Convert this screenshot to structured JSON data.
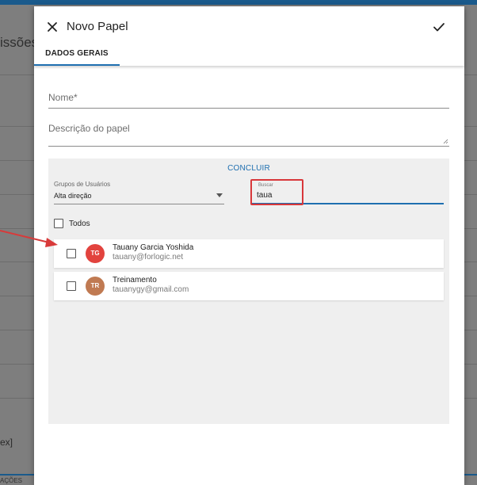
{
  "background": {
    "title_fragment": "issões",
    "snippet_fragment": "ex]",
    "bottom_tab_fragment": "AÇÕES"
  },
  "dialog": {
    "title": "Novo Papel",
    "tabs": [
      {
        "label": "DADOS GERAIS"
      }
    ],
    "fields": {
      "nome_label": "Nome*",
      "descricao_label": "Descrição do papel"
    },
    "panel": {
      "concluir_label": "CONCLUIR",
      "groups_label": "Grupos de Usuários",
      "groups_value": "Alta direção",
      "search_label": "Buscar",
      "search_value": "taua",
      "todos_label": "Todos",
      "users": [
        {
          "initials": "TG",
          "name": "Tauany Garcia Yoshida",
          "email": "tauany@forlogic.net",
          "avatar_color": "#e2433e"
        },
        {
          "initials": "TR",
          "name": "Treinamento",
          "email": "tauanygy@gmail.com",
          "avatar_color": "#c07a52"
        }
      ]
    }
  },
  "colors": {
    "accent": "#1e6fb0",
    "highlight": "#d8373a",
    "annotation_arrow": "#d83a3a"
  },
  "icons": {
    "close": "close-icon",
    "confirm": "check-icon",
    "dropdown": "chevron-down-icon",
    "annotation": "arrow-annotation"
  }
}
